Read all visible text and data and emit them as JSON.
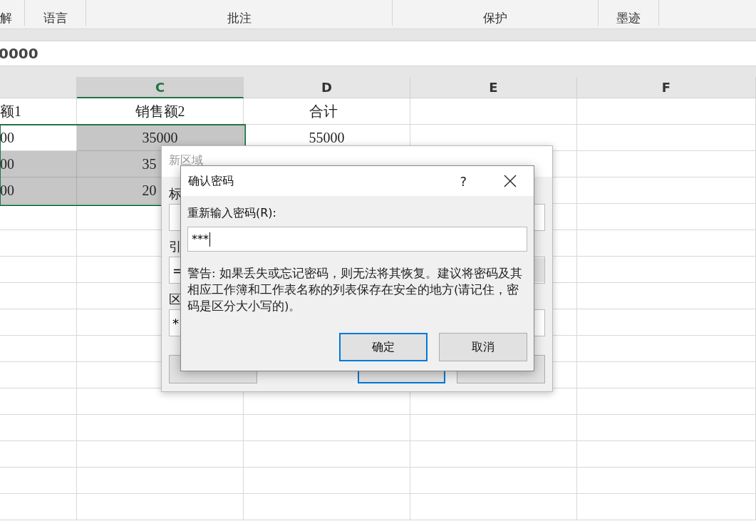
{
  "ribbon": {
    "groups": [
      {
        "label": "解"
      },
      {
        "label": "语言"
      },
      {
        "label": "批注"
      },
      {
        "label": "保护"
      },
      {
        "label": "墨迹"
      }
    ]
  },
  "formula_bar": {
    "value": "0000"
  },
  "sheet": {
    "columns": [
      {
        "selected": false
      },
      {
        "label": "C",
        "selected": true
      },
      {
        "label": "D",
        "selected": false
      },
      {
        "label": "E",
        "selected": false
      },
      {
        "label": "F",
        "selected": false
      }
    ],
    "rows": [
      {
        "cells": [
          {
            "text": "额1",
            "selected": false
          },
          {
            "text": "销售额2",
            "selected": false
          },
          {
            "text": "合计",
            "selected": false
          },
          {},
          {}
        ]
      },
      {
        "cells": [
          {
            "text": "00",
            "selected": false
          },
          {
            "text": "35000",
            "selected": true
          },
          {
            "text": "55000",
            "selected": false
          },
          {},
          {}
        ]
      },
      {
        "cells": [
          {
            "text": "00",
            "selected": true
          },
          {
            "text": "35",
            "selected": true
          },
          null,
          {},
          {}
        ]
      },
      {
        "cells": [
          {
            "text": "00",
            "selected": true
          },
          {
            "text": "20",
            "selected": true
          },
          null,
          {},
          {}
        ]
      }
    ]
  },
  "back_dialog": {
    "title": "新区域",
    "fields": [
      {
        "label": "标"
      },
      {
        "label": "引",
        "value": "=",
        "has_button": true
      },
      {
        "label": "区",
        "value": "*"
      }
    ],
    "buttons": [
      {
        "default": false
      },
      {
        "default": true
      },
      {
        "default": false
      }
    ]
  },
  "dialog": {
    "title": "确认密码",
    "help": "?",
    "label": "重新输入密码(R):",
    "password": "***",
    "warning": "警告: 如果丢失或忘记密码，则无法将其恢复。建议将密码及其相应工作簿和工作表名称的列表保存在安全的地方(请记住，密码是区分大小写的)。",
    "buttons": [
      {
        "label": "确定",
        "default": true
      },
      {
        "label": "取消",
        "default": false
      }
    ]
  }
}
